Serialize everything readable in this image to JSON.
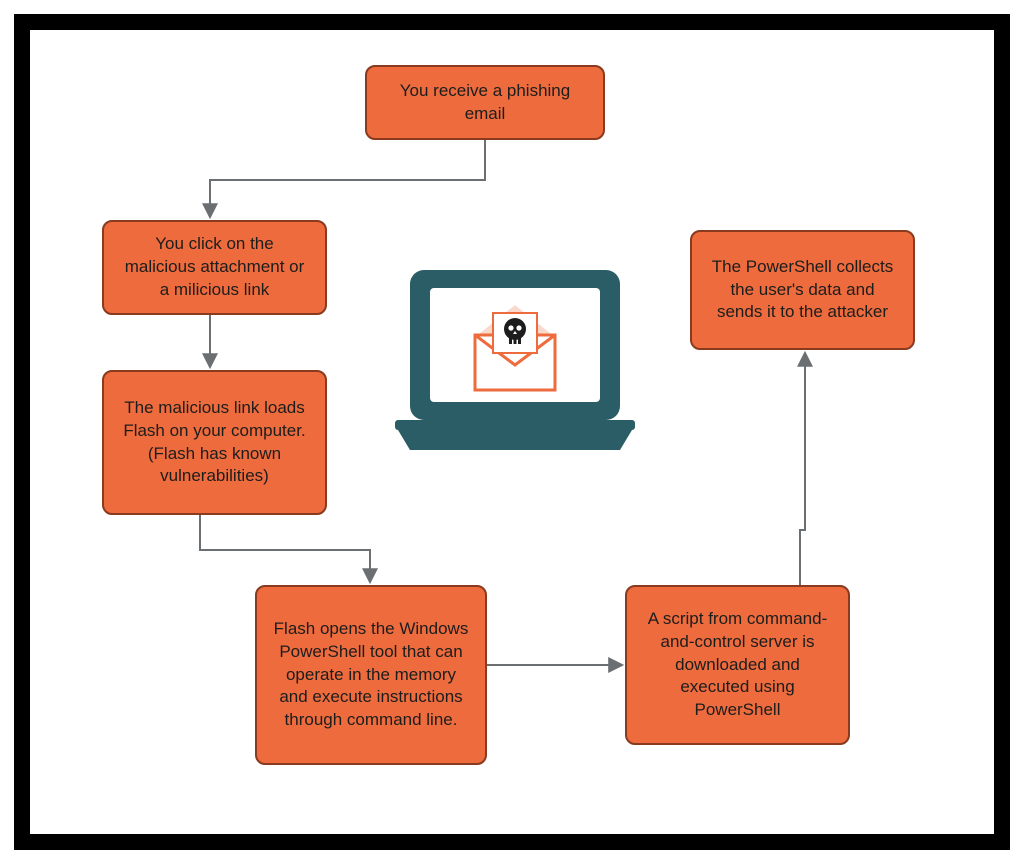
{
  "diagram": {
    "nodes": {
      "n1": "You receive a phishing email",
      "n2": "You click on the malicious attachment or a milicious link",
      "n3": "The malicious link loads Flash on your computer.\n(Flash has known vulnerabilities)",
      "n4": "Flash opens the Windows PowerShell tool that can operate in the memory and execute instructions through command line.",
      "n5": "A script from command-and-control server is downloaded and executed using PowerShell",
      "n6": "The PowerShell collects the user's data and sends it to the attacker"
    },
    "edges": [
      {
        "from": "n1",
        "to": "n2"
      },
      {
        "from": "n2",
        "to": "n3"
      },
      {
        "from": "n3",
        "to": "n4"
      },
      {
        "from": "n4",
        "to": "n5"
      },
      {
        "from": "n5",
        "to": "n6"
      }
    ],
    "center_icon": "laptop-malware-icon",
    "colors": {
      "node_fill": "#ed6b3c",
      "node_stroke": "#8a3a1e",
      "arrow": "#6b6f72",
      "laptop": "#2a5d66",
      "laptop_accent": "#ed6b3c"
    }
  }
}
